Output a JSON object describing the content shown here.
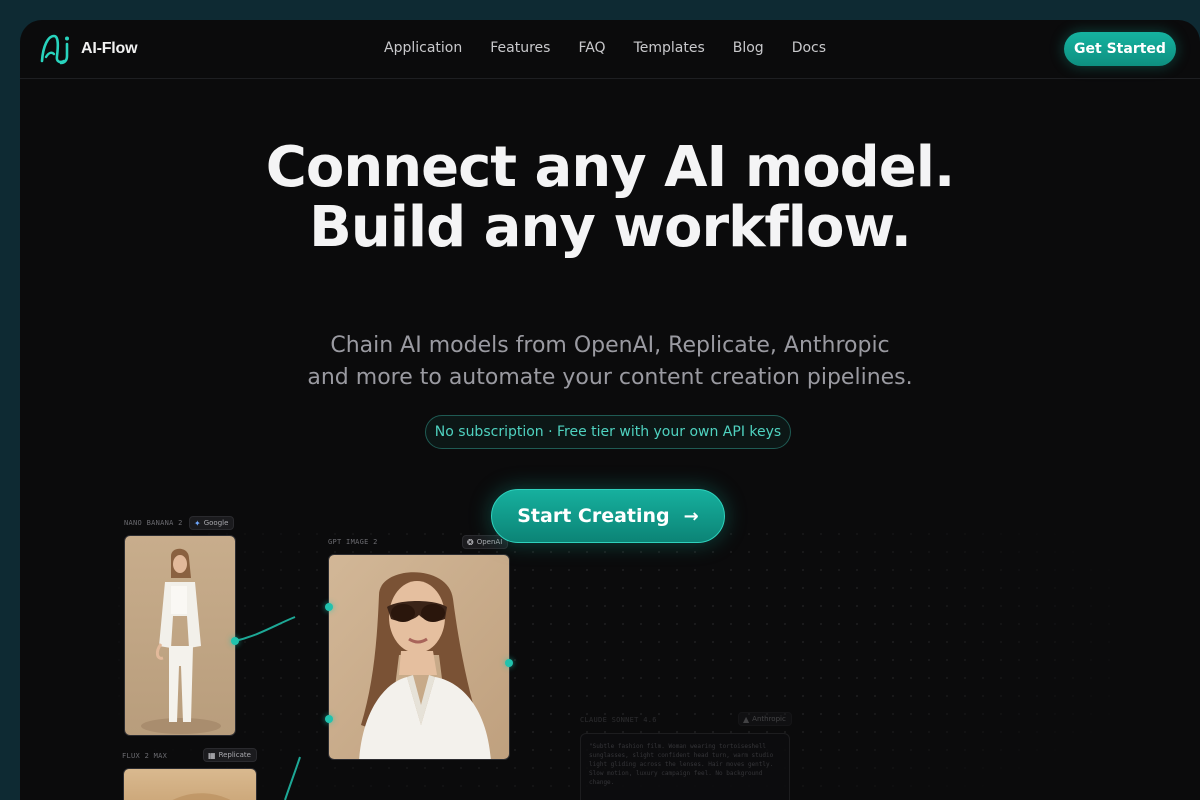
{
  "brand": {
    "name": "AI-Flow"
  },
  "nav": {
    "links": [
      "Application",
      "Features",
      "FAQ",
      "Templates",
      "Blog",
      "Docs"
    ],
    "cta": "Get Started"
  },
  "hero": {
    "title_line1": "Connect any AI model.",
    "title_line2": "Build any workflow.",
    "subtitle_line1": "Chain AI models from OpenAI, Replicate, Anthropic",
    "subtitle_line2": "and more to automate your content creation pipelines.",
    "pill": "No subscription · Free tier with your own API keys",
    "cta": "Start Creating"
  },
  "canvas": {
    "nodes": [
      {
        "label": "NANO BANANA 2",
        "provider": "Google"
      },
      {
        "label": "GPT IMAGE 2",
        "provider": "OpenAI"
      },
      {
        "label": "FLUX 2 MAX",
        "provider": "Replicate"
      },
      {
        "label": "CLAUDE SONNET 4.6",
        "provider": "Anthropic"
      }
    ],
    "prompt_text": "\"Subtle fashion film. Woman wearing tortoiseshell sunglasses, slight confident head turn, warm studio light gliding across the lenses. Hair moves gently. Slow motion, luxury campaign feel. No background change."
  },
  "colors": {
    "accent": "#16b09e",
    "page_bg": "#0b0b0c",
    "outer_bg": "#0e2a33"
  }
}
